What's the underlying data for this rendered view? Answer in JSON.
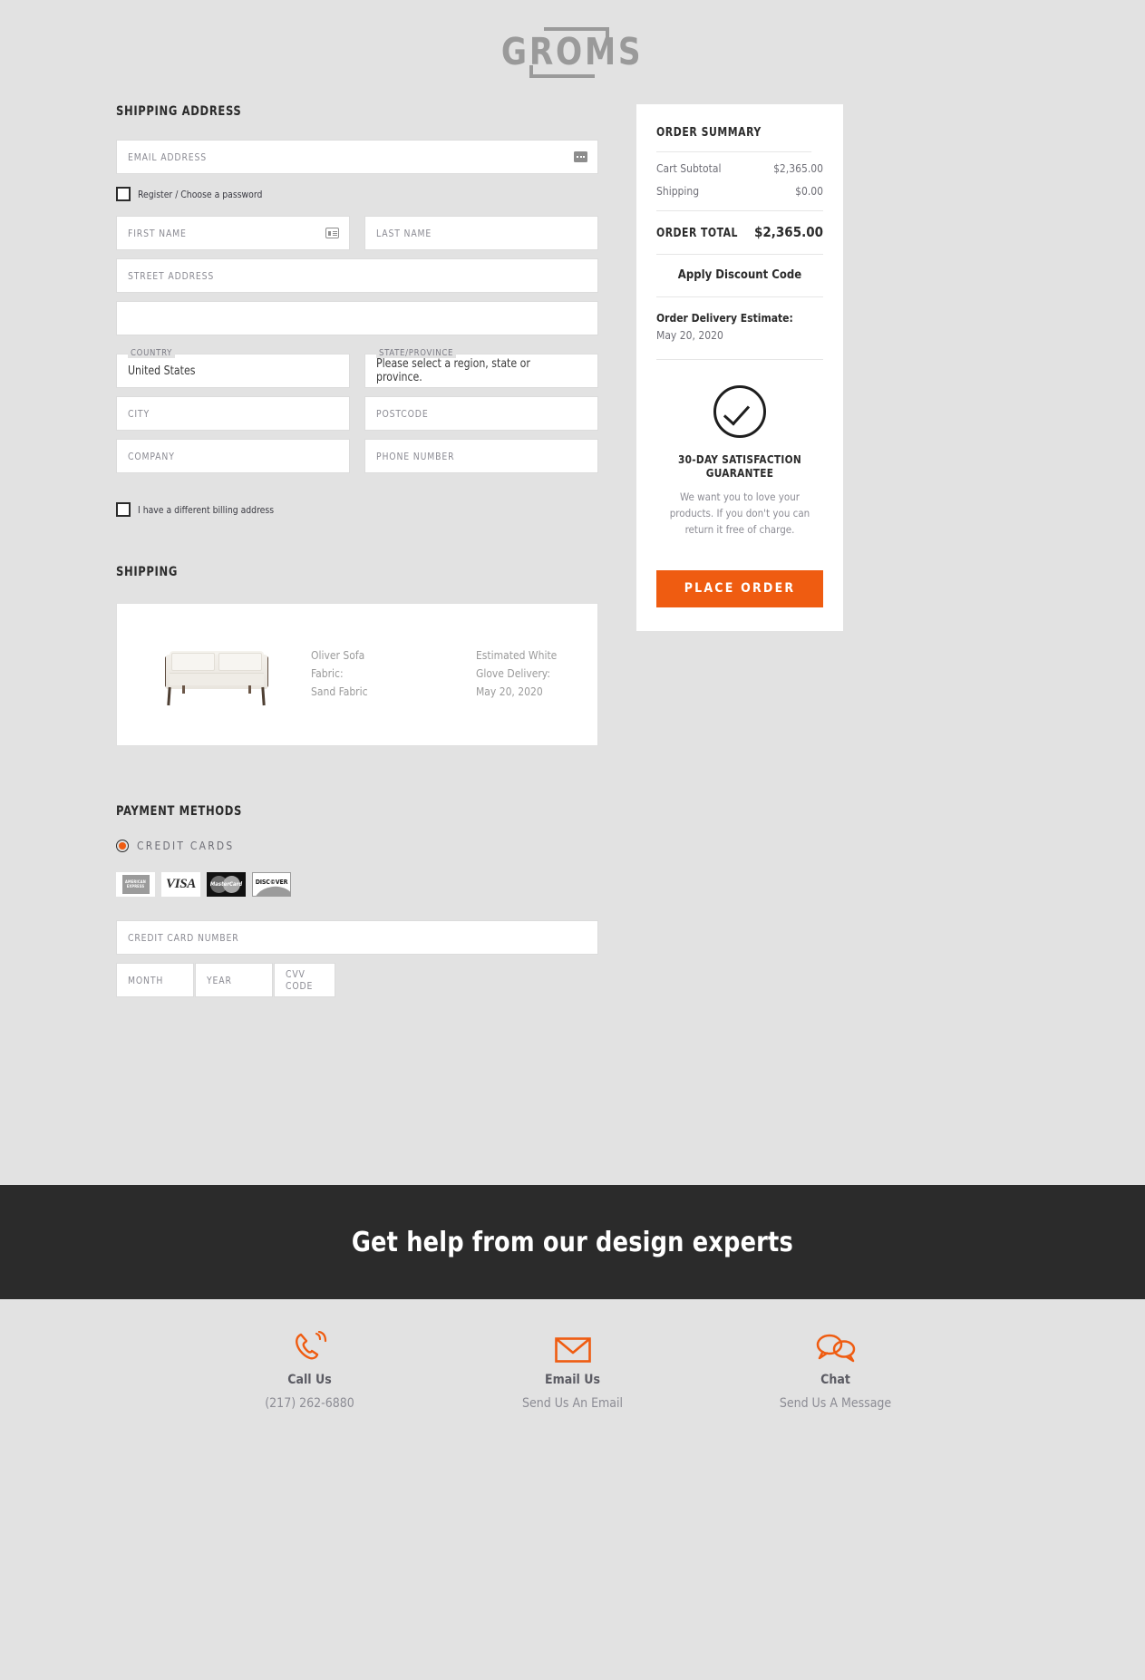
{
  "brand": {
    "logo_text": "GROMS",
    "accent_color": "#ef5c11",
    "dark_color": "#2b2b2b",
    "page_background": "#e2e2e2"
  },
  "shipping_address": {
    "heading": "SHIPPING ADDRESS",
    "email_placeholder": "EMAIL ADDRESS",
    "register_checkbox_label": "Register / Choose a password",
    "first_name_placeholder": "FIRST NAME",
    "last_name_placeholder": "LAST NAME",
    "street_address_placeholder": "STREET ADDRESS",
    "street_address_2_placeholder": "",
    "country_label": "COUNTRY",
    "country_value": "United States",
    "state_label": "STATE/PROVINCE",
    "state_value": "Please select a region, state or province.",
    "city_placeholder": "CITY",
    "postcode_placeholder": "POSTCODE",
    "company_placeholder": "COMPANY",
    "phone_placeholder": "PHONE NUMBER",
    "billing_checkbox_label": "I have a different billing address"
  },
  "shipping": {
    "heading": "SHIPPING",
    "product_name": "Oliver Sofa",
    "product_fabric": "Fabric: Sand Fabric",
    "delivery_label": "Estimated White Glove Delivery:",
    "delivery_date": "May 20, 2020"
  },
  "payment": {
    "heading": "PAYMENT METHODS",
    "method_label": "CREDIT CARDS",
    "card_logos": [
      "AMERICAN EXPRESS",
      "VISA",
      "MasterCard",
      "DISC©VER"
    ],
    "card_number_placeholder": "CREDIT CARD NUMBER",
    "month_placeholder": "MONTH",
    "year_placeholder": "YEAR",
    "cvv_placeholder": "CVV CODE"
  },
  "order_summary": {
    "title": "ORDER SUMMARY",
    "lines": [
      {
        "label": "Cart Subtotal",
        "value": "$2,365.00"
      },
      {
        "label": "Shipping",
        "value": "$0.00"
      }
    ],
    "total_label": "ORDER TOTAL",
    "total_value": "$2,365.00",
    "discount_link": "Apply Discount Code",
    "delivery_estimate_label": "Order Delivery Estimate:",
    "delivery_estimate_value": "May 20, 2020",
    "guarantee_title": "30-DAY SATISFACTION GUARANTEE",
    "guarantee_body": "We want you to love your products. If you don't you can return it free of charge.",
    "place_order_label": "PLACE ORDER"
  },
  "help_band": {
    "heading": "Get help from our design experts"
  },
  "contact": {
    "items": [
      {
        "icon": "phone-icon",
        "title": "Call Us",
        "subtitle": "(217) 262-6880"
      },
      {
        "icon": "envelope-icon",
        "title": "Email Us",
        "subtitle": "Send Us An Email"
      },
      {
        "icon": "chat-icon",
        "title": "Chat",
        "subtitle": "Send Us A Message"
      }
    ]
  }
}
